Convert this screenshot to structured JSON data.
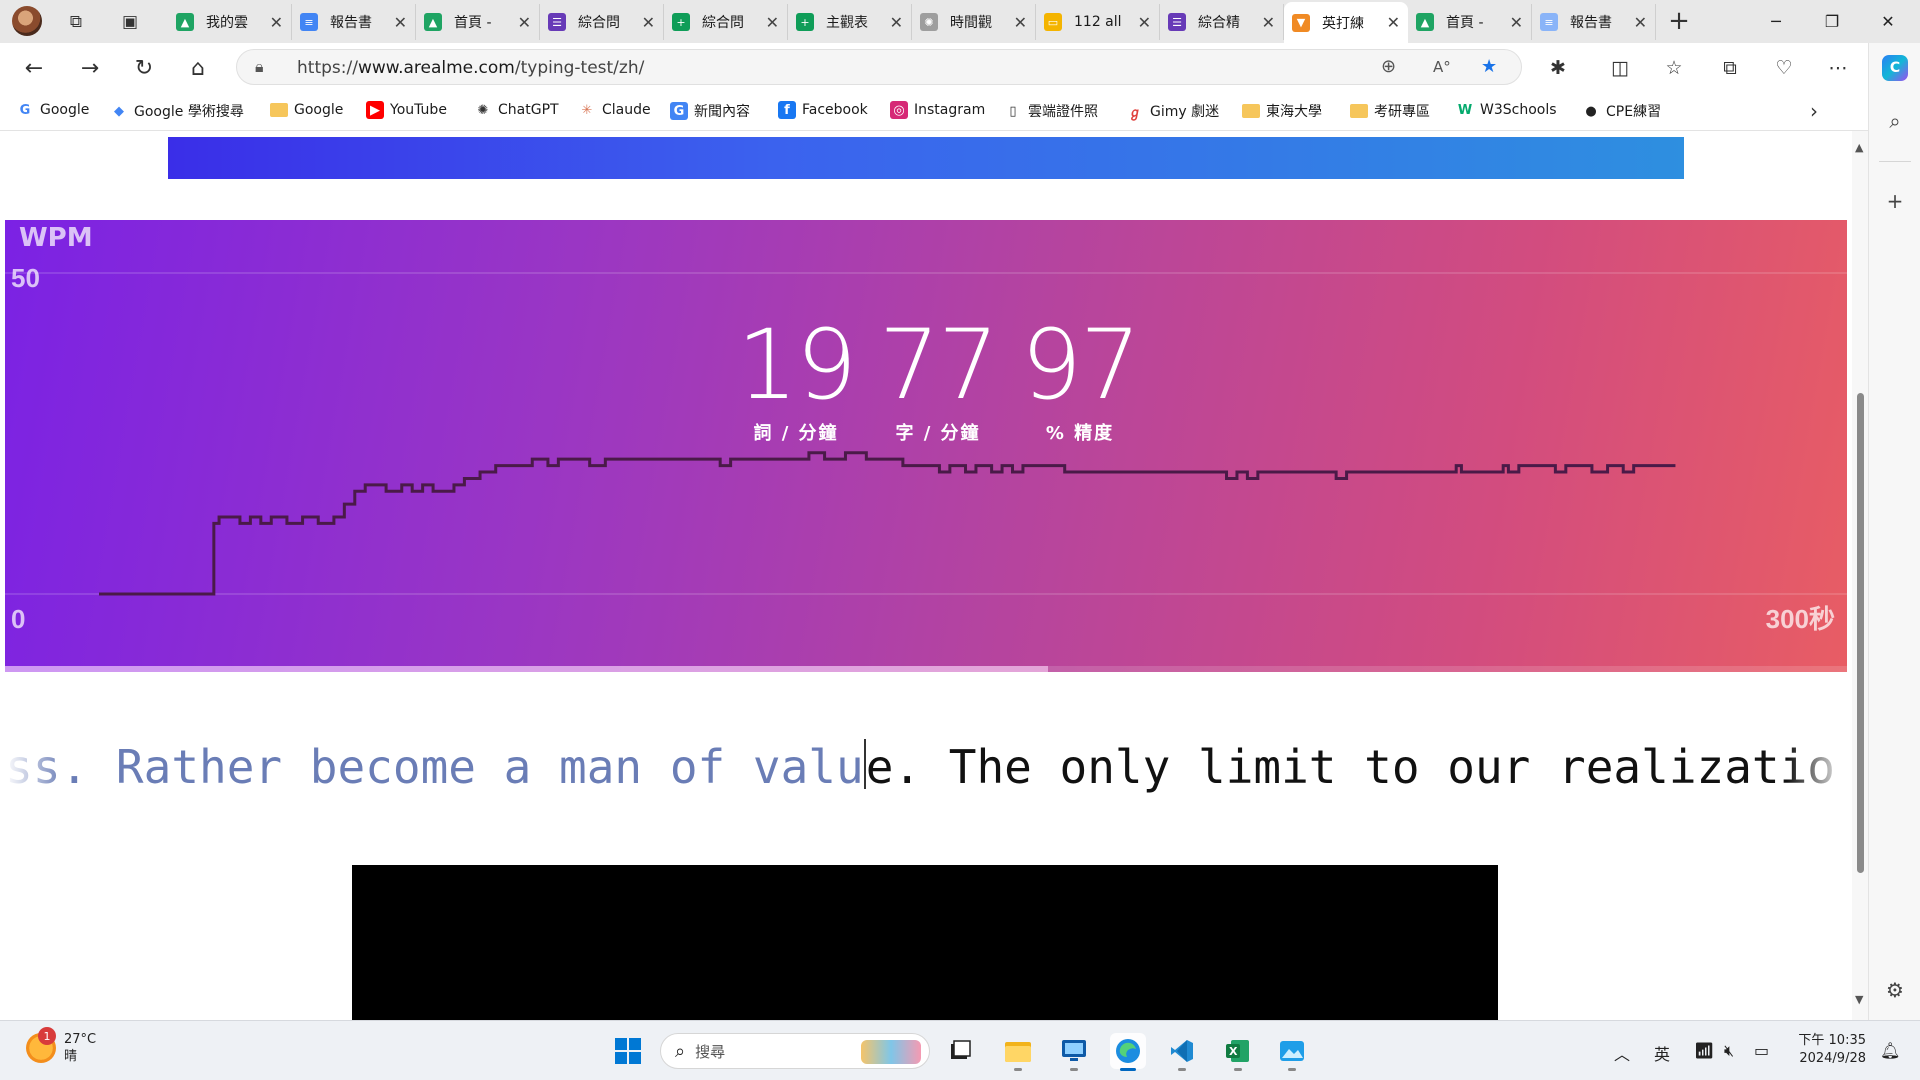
{
  "browser": {
    "tabs": [
      {
        "label": "我的雲",
        "icon": "google-drive-icon",
        "color": "#1fa463"
      },
      {
        "label": "報告書",
        "icon": "google-docs-icon",
        "color": "#4285f4"
      },
      {
        "label": "首頁 -",
        "icon": "google-drive-icon",
        "color": "#1fa463"
      },
      {
        "label": "綜合問",
        "icon": "google-forms-icon",
        "color": "#673ab7"
      },
      {
        "label": "綜合問",
        "icon": "google-sheets-icon",
        "color": "#0f9d58"
      },
      {
        "label": "主觀表",
        "icon": "google-sheets-icon",
        "color": "#0f9d58"
      },
      {
        "label": "時間觀",
        "icon": "chatgpt-icon",
        "color": "#9e9e9e"
      },
      {
        "label": "112 all",
        "icon": "google-slides-icon",
        "color": "#f4b400"
      },
      {
        "label": "綜合精",
        "icon": "google-forms-icon",
        "color": "#673ab7"
      },
      {
        "label": "英打練",
        "icon": "fox-icon",
        "color": "#f08a24"
      },
      {
        "label": "首頁 -",
        "icon": "google-drive-icon",
        "color": "#1fa463"
      },
      {
        "label": "報告書",
        "icon": "google-docs-icon",
        "color": "#8ab4f8"
      }
    ],
    "active_tab_index": 9,
    "url_prefix": "https://",
    "url_host": "www.arealme.com",
    "url_path": "/typing-test/zh/"
  },
  "bookmarks": [
    {
      "label": "Google",
      "icon": "google-g-icon"
    },
    {
      "label": "Google 學術搜尋",
      "icon": "scholar-icon"
    },
    {
      "label": "Google",
      "icon": "folder-icon"
    },
    {
      "label": "YouTube",
      "icon": "youtube-icon"
    },
    {
      "label": "ChatGPT",
      "icon": "chatgpt-icon"
    },
    {
      "label": "Claude",
      "icon": "claude-icon"
    },
    {
      "label": "新聞內容",
      "icon": "news-icon"
    },
    {
      "label": "Facebook",
      "icon": "facebook-icon"
    },
    {
      "label": "Instagram",
      "icon": "instagram-icon"
    },
    {
      "label": "雲端證件照",
      "icon": "page-icon"
    },
    {
      "label": "Gimy 劇迷",
      "icon": "gimy-icon"
    },
    {
      "label": "東海大學",
      "icon": "folder-icon"
    },
    {
      "label": "考研專區",
      "icon": "folder-icon"
    },
    {
      "label": "W3Schools",
      "icon": "w3schools-icon"
    },
    {
      "label": "CPE練習",
      "icon": "github-icon"
    }
  ],
  "results": {
    "wpm": "19",
    "wpm_label": "詞 / 分鐘",
    "cpm": "77",
    "cpm_label": "字 / 分鐘",
    "accuracy": "97",
    "accuracy_label": "% 精度",
    "progress_fraction": 0.566
  },
  "chart_data": {
    "type": "line",
    "title": "WPM",
    "ylabel": "WPM",
    "xlabel": "",
    "ylim": [
      0,
      50
    ],
    "xlim": [
      0,
      300
    ],
    "y_tick_labels": [
      "50",
      "0"
    ],
    "x_end_label": "300秒",
    "step": true,
    "series": [
      {
        "values": [
          {
            "t": 0,
            "wpm": 0
          },
          {
            "t": 21,
            "wpm": 0
          },
          {
            "t": 22,
            "wpm": 11
          },
          {
            "t": 23,
            "wpm": 12
          },
          {
            "t": 27,
            "wpm": 11
          },
          {
            "t": 29,
            "wpm": 12
          },
          {
            "t": 31,
            "wpm": 11
          },
          {
            "t": 33,
            "wpm": 12
          },
          {
            "t": 36,
            "wpm": 11
          },
          {
            "t": 39,
            "wpm": 12
          },
          {
            "t": 42,
            "wpm": 11
          },
          {
            "t": 45,
            "wpm": 12
          },
          {
            "t": 47,
            "wpm": 14
          },
          {
            "t": 49,
            "wpm": 16
          },
          {
            "t": 51,
            "wpm": 17
          },
          {
            "t": 55,
            "wpm": 16
          },
          {
            "t": 58,
            "wpm": 17
          },
          {
            "t": 60,
            "wpm": 16
          },
          {
            "t": 62,
            "wpm": 17
          },
          {
            "t": 64,
            "wpm": 16
          },
          {
            "t": 68,
            "wpm": 17
          },
          {
            "t": 70,
            "wpm": 18
          },
          {
            "t": 73,
            "wpm": 19
          },
          {
            "t": 76,
            "wpm": 20
          },
          {
            "t": 80,
            "wpm": 20
          },
          {
            "t": 83,
            "wpm": 21
          },
          {
            "t": 86,
            "wpm": 20
          },
          {
            "t": 88,
            "wpm": 21
          },
          {
            "t": 92,
            "wpm": 21
          },
          {
            "t": 94,
            "wpm": 20
          },
          {
            "t": 97,
            "wpm": 21
          },
          {
            "t": 101,
            "wpm": 21
          },
          {
            "t": 107,
            "wpm": 21
          },
          {
            "t": 111,
            "wpm": 21
          },
          {
            "t": 117,
            "wpm": 21
          },
          {
            "t": 119,
            "wpm": 20
          },
          {
            "t": 121,
            "wpm": 21
          },
          {
            "t": 130,
            "wpm": 21
          },
          {
            "t": 134,
            "wpm": 21
          },
          {
            "t": 136,
            "wpm": 22
          },
          {
            "t": 139,
            "wpm": 21
          },
          {
            "t": 143,
            "wpm": 22
          },
          {
            "t": 147,
            "wpm": 21
          },
          {
            "t": 152,
            "wpm": 21
          },
          {
            "t": 154,
            "wpm": 20
          },
          {
            "t": 158,
            "wpm": 20
          },
          {
            "t": 161,
            "wpm": 19
          },
          {
            "t": 163,
            "wpm": 20
          },
          {
            "t": 166,
            "wpm": 19
          },
          {
            "t": 168,
            "wpm": 20
          },
          {
            "t": 171,
            "wpm": 19
          },
          {
            "t": 173,
            "wpm": 20
          },
          {
            "t": 175,
            "wpm": 19
          },
          {
            "t": 177,
            "wpm": 20
          },
          {
            "t": 183,
            "wpm": 20
          },
          {
            "t": 185,
            "wpm": 19
          },
          {
            "t": 205,
            "wpm": 19
          },
          {
            "t": 214,
            "wpm": 19
          },
          {
            "t": 216,
            "wpm": 18
          },
          {
            "t": 218,
            "wpm": 19
          },
          {
            "t": 220,
            "wpm": 18
          },
          {
            "t": 222,
            "wpm": 19
          },
          {
            "t": 235,
            "wpm": 19
          },
          {
            "t": 237,
            "wpm": 18
          },
          {
            "t": 239,
            "wpm": 19
          },
          {
            "t": 259,
            "wpm": 19
          },
          {
            "t": 260,
            "wpm": 20
          },
          {
            "t": 261,
            "wpm": 19
          },
          {
            "t": 268,
            "wpm": 19
          },
          {
            "t": 269,
            "wpm": 20
          },
          {
            "t": 270,
            "wpm": 19
          },
          {
            "t": 272,
            "wpm": 20
          },
          {
            "t": 277,
            "wpm": 20
          },
          {
            "t": 279,
            "wpm": 19
          },
          {
            "t": 281,
            "wpm": 20
          },
          {
            "t": 284,
            "wpm": 20
          },
          {
            "t": 286,
            "wpm": 19
          },
          {
            "t": 289,
            "wpm": 20
          },
          {
            "t": 292,
            "wpm": 19
          },
          {
            "t": 294,
            "wpm": 20
          },
          {
            "t": 297,
            "wpm": 20
          },
          {
            "t": 302,
            "wpm": 20
          }
        ]
      }
    ],
    "grid": false
  },
  "typing": {
    "typed": "uccess. Rather become a man of valu",
    "untyped": "e. The only limit to our realizatio"
  },
  "taskbar": {
    "temperature": "27°C",
    "weather": "晴",
    "weather_badge": "1",
    "search_placeholder": "搜尋",
    "ime": "英",
    "time": "下午 10:35",
    "date": "2024/9/28"
  },
  "colors": {
    "chart_line": "#4a1a48",
    "typed_text": "#6a7db6",
    "bookmark_star": "#1a73e8"
  }
}
